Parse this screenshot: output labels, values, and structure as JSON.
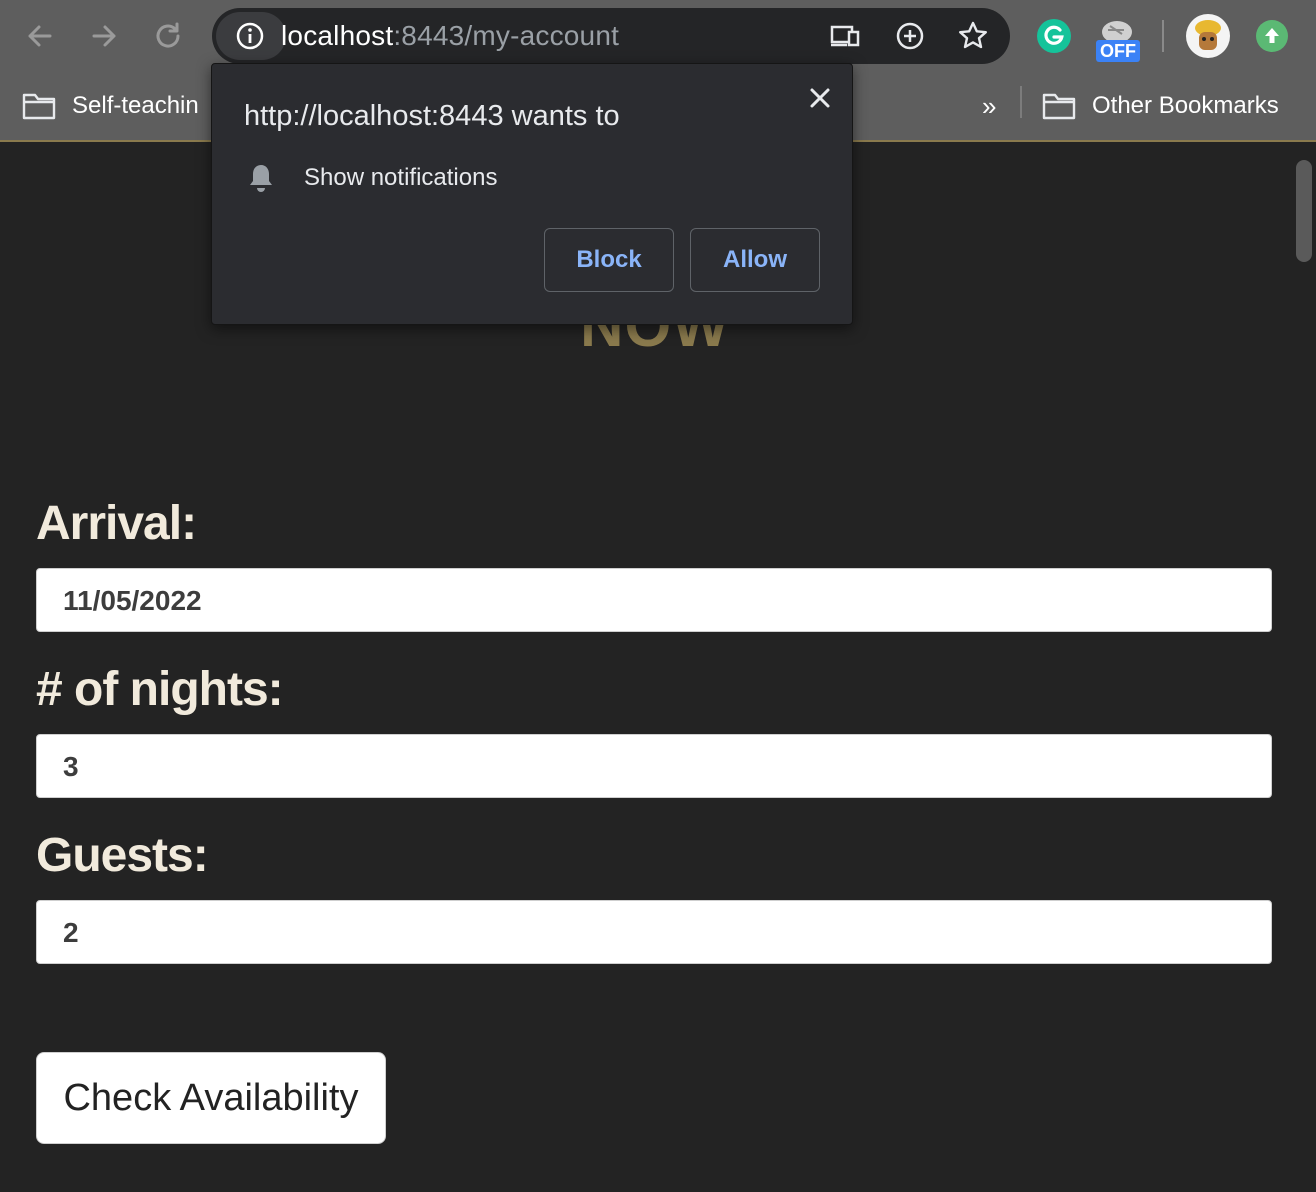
{
  "browser": {
    "url_host": "localhost",
    "url_path": ":8443/my-account",
    "bookmarks": {
      "first": "Self-teachin",
      "overflow": "»",
      "other": "Other Bookmarks"
    },
    "extensions": {
      "off_badge": "OFF"
    },
    "icons": [
      "back-icon",
      "forward-icon",
      "reload-icon",
      "info-icon",
      "cast-icon",
      "zoom-icon",
      "star-icon",
      "grammarly-icon",
      "extension-off-icon",
      "avatar-icon",
      "update-icon",
      "folder-icon"
    ]
  },
  "page": {
    "heading_fragment": "NOW",
    "arrival_label": "Arrival:",
    "arrival_value": "11/05/2022",
    "nights_label": "# of nights:",
    "nights_value": "3",
    "guests_label": "Guests:",
    "guests_value": "2",
    "check_button": "Check Availability"
  },
  "popup": {
    "title": "http://localhost:8443 wants to",
    "permission": "Show notifications",
    "block_label": "Block",
    "allow_label": "Allow"
  },
  "colors": {
    "page_bg": "#232323",
    "accent_gold": "#8a7a4d",
    "label_cream": "#f1eadc",
    "link_blue": "#8ab4f8"
  }
}
